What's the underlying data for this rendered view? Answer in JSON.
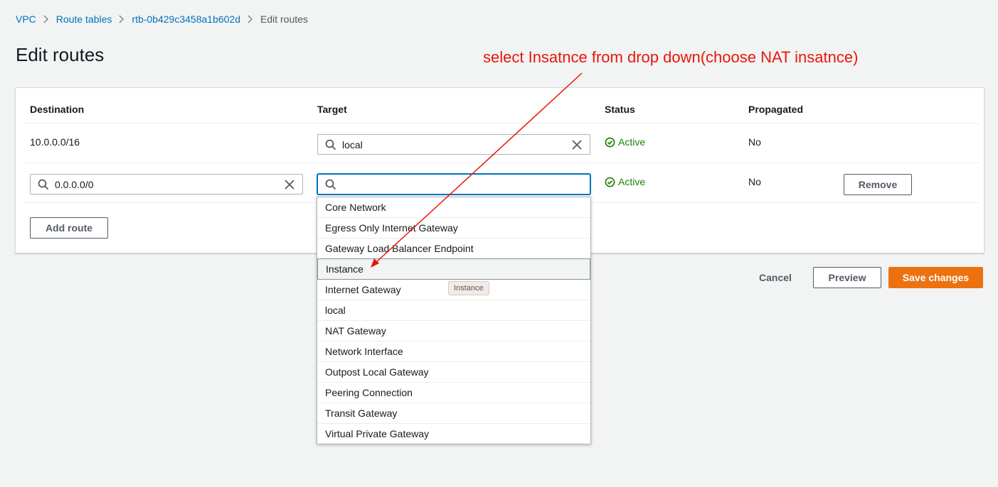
{
  "breadcrumb": {
    "items": [
      "VPC",
      "Route tables",
      "rtb-0b429c3458a1b602d"
    ],
    "current": "Edit routes"
  },
  "page": {
    "title": "Edit routes"
  },
  "annotation": {
    "text": "select Insatnce from drop down(choose NAT insatnce)",
    "color": "#e8170a"
  },
  "table": {
    "headers": [
      "Destination",
      "Target",
      "Status",
      "Propagated"
    ],
    "rows": [
      {
        "destination": "10.0.0.0/16",
        "target": "local",
        "status": "Active",
        "propagated": "No"
      },
      {
        "destination": "0.0.0.0/0",
        "target": "",
        "status": "Active",
        "propagated": "No",
        "remove_label": "Remove"
      }
    ]
  },
  "add_route_label": "Add route",
  "dropdown": {
    "options": [
      "Core Network",
      "Egress Only Internet Gateway",
      "Gateway Load Balancer Endpoint",
      "Instance",
      "Internet Gateway",
      "local",
      "NAT Gateway",
      "Network Interface",
      "Outpost Local Gateway",
      "Peering Connection",
      "Transit Gateway",
      "Virtual Private Gateway"
    ],
    "highlighted": "Instance",
    "tooltip": "Instance"
  },
  "footer": {
    "cancel_label": "Cancel",
    "preview_label": "Preview",
    "save_label": "Save changes"
  },
  "colors": {
    "link": "#0073bb",
    "success": "#1d8102",
    "primary": "#ec7211",
    "background": "#f2f3f3"
  }
}
